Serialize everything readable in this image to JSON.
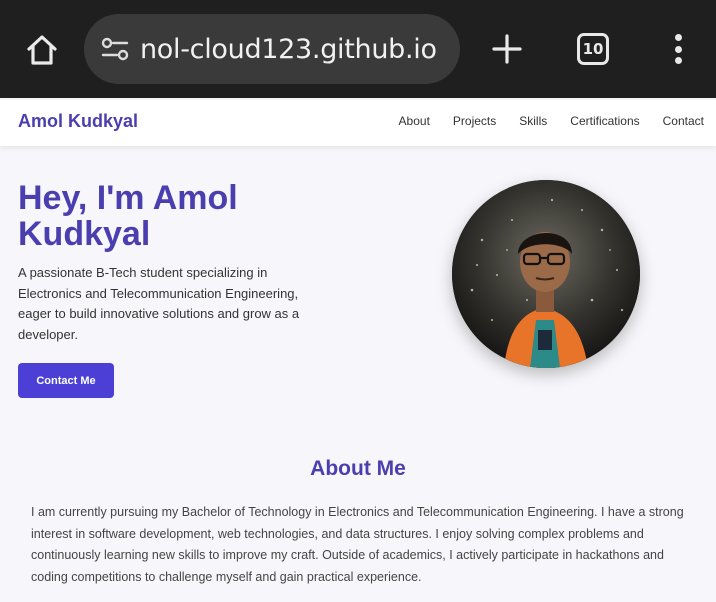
{
  "browser": {
    "url": "nol-cloud123.github.io",
    "tab_count": "10"
  },
  "nav": {
    "brand": "Amol Kudkyal",
    "links": [
      "About",
      "Projects",
      "Skills",
      "Certifications",
      "Contact"
    ]
  },
  "hero": {
    "title": "Hey, I'm Amol Kudkyal",
    "description": "A passionate B-Tech student specializing in Electronics and Telecommunication Engineering, eager to build innovative solutions and grow as a developer.",
    "button": "Contact Me"
  },
  "about": {
    "title": "About Me",
    "text": "I am currently pursuing my Bachelor of Technology in Electronics and Telecommunication Engineering. I have a strong interest in software development, web technologies, and data structures. I enjoy solving complex problems and continuously learning new skills to improve my craft. Outside of academics, I actively participate in hackathons and coding competitions to challenge myself and gain practical experience."
  },
  "colors": {
    "accent": "#4b3fb0",
    "button": "#4b3fd6"
  }
}
